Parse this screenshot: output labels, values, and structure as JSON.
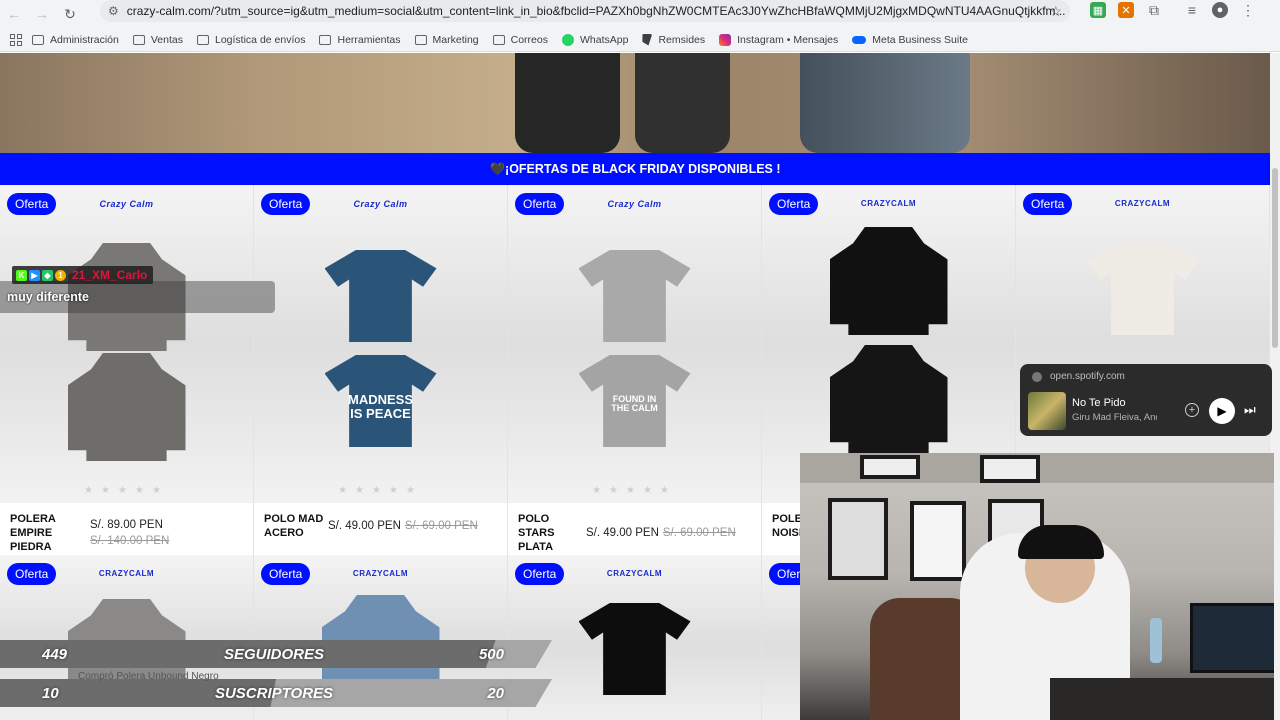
{
  "browser": {
    "url": "crazy-calm.com/?utm_source=ig&utm_medium=social&utm_content=link_in_bio&fbclid=PAZXh0bgNhZW0CMTEAc3J0YwZhcHBfaWQMMjU2MjgxMDQwNTU4AAGnuQtjkkfm...",
    "bookmarks": [
      {
        "label": "Administración",
        "icon": "folder-icon"
      },
      {
        "label": "Ventas",
        "icon": "folder-icon"
      },
      {
        "label": "Logística de envíos",
        "icon": "folder-icon"
      },
      {
        "label": "Herramientas",
        "icon": "folder-icon"
      },
      {
        "label": "Marketing",
        "icon": "folder-icon"
      },
      {
        "label": "Correos",
        "icon": "folder-icon"
      },
      {
        "label": "WhatsApp",
        "icon": "whatsapp-icon"
      },
      {
        "label": "Remsides",
        "icon": "remsides-icon"
      },
      {
        "label": "Instagram • Mensajes",
        "icon": "instagram-icon"
      },
      {
        "label": "Meta Business Suite",
        "icon": "meta-icon"
      }
    ]
  },
  "site": {
    "banner": "🖤¡OFERTAS DE BLACK FRIDAY DISPONIBLES !",
    "badge": "Oferta",
    "accent": "#0010ff",
    "products": [
      {
        "name": "POLERA EMPIRE PIEDRA",
        "price": "S/. 89.00 PEN",
        "old_price": "S/. 140.00 PEN",
        "color": "#7a7875",
        "type": "hoodie"
      },
      {
        "name": "POLO MAD ACERO",
        "price": "S/. 49.00 PEN",
        "old_price": "S/. 69.00 PEN",
        "color": "#2a5478",
        "type": "tee",
        "print": "MADNESS IS PEACE"
      },
      {
        "name": "POLO STARS PLATA",
        "price": "S/. 49.00 PEN",
        "old_price": "S/. 69.00 PEN",
        "color": "#a9a9a9",
        "type": "tee",
        "print": "FOUND IN THE CALM"
      },
      {
        "name": "POLE NOISE",
        "price": "",
        "old_price": "",
        "color": "#111111",
        "type": "hoodie"
      },
      {
        "name": "",
        "price": "",
        "old_price": "",
        "color": "#efece6",
        "type": "tee"
      }
    ],
    "row2_brand": "CRAZYCALM"
  },
  "chat": {
    "username": "21_XM_Carlo",
    "message": "muy diferente"
  },
  "spotify": {
    "site": "open.spotify.com",
    "track": "No Te Pido",
    "artist": "Giru Mad Fleiva, And"
  },
  "goals": {
    "followers": {
      "current": "449",
      "label": "SEGUIDORES",
      "target": "500",
      "progress": 0.898
    },
    "subscribers": {
      "current": "10",
      "label": "SUSCRIPTORES",
      "target": "20",
      "progress": 0.5
    },
    "purchase_note": "Compró Polera Unbound Negro"
  }
}
